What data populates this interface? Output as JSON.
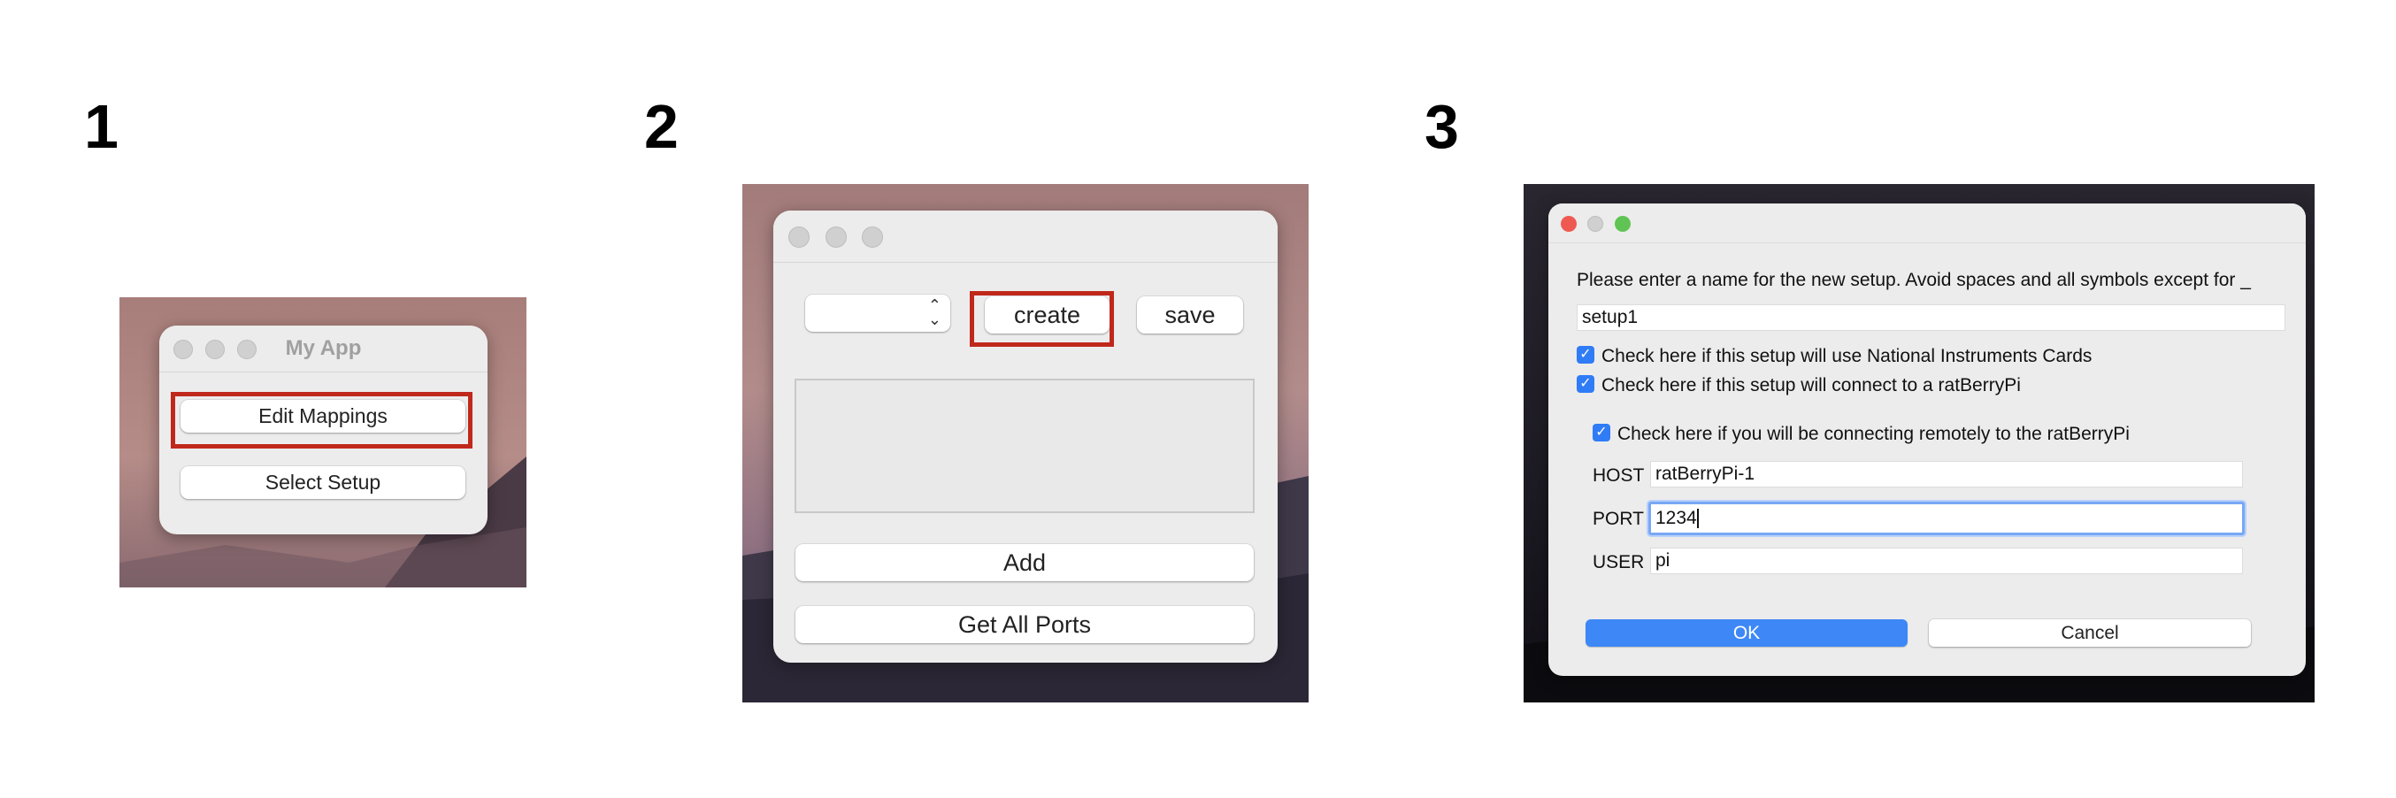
{
  "steps": [
    "1",
    "2",
    "3"
  ],
  "panel1": {
    "window_title": "My App",
    "edit_mappings_label": "Edit Mappings",
    "select_setup_label": "Select Setup"
  },
  "panel2": {
    "dropdown_value": "",
    "create_label": "create",
    "save_label": "save",
    "add_label": "Add",
    "get_all_ports_label": "Get All Ports"
  },
  "panel3": {
    "prompt": "Please enter a name for the new setup. Avoid spaces and all symbols except for _",
    "setup_name": "setup1",
    "ni_cards_label": "Check here if this setup will use National Instruments Cards",
    "ratberry_label": "Check here if this setup will connect to a ratBerryPi",
    "remote_label": "Check here if you will be connecting remotely to the ratBerryPi",
    "host_label": "HOST",
    "host_value": "ratBerryPi-1",
    "port_label": "PORT",
    "port_value": "1234",
    "user_label": "USER",
    "user_value": "pi",
    "ok_label": "OK",
    "cancel_label": "Cancel",
    "ni_checked": true,
    "ratberry_checked": true,
    "remote_checked": true
  },
  "colors": {
    "highlight": "#c0281c",
    "accent": "#2f7cf6",
    "close_red": "#ee5a52",
    "minimize_grey": "#d0d0d0",
    "zoom_green": "#5fc453"
  }
}
